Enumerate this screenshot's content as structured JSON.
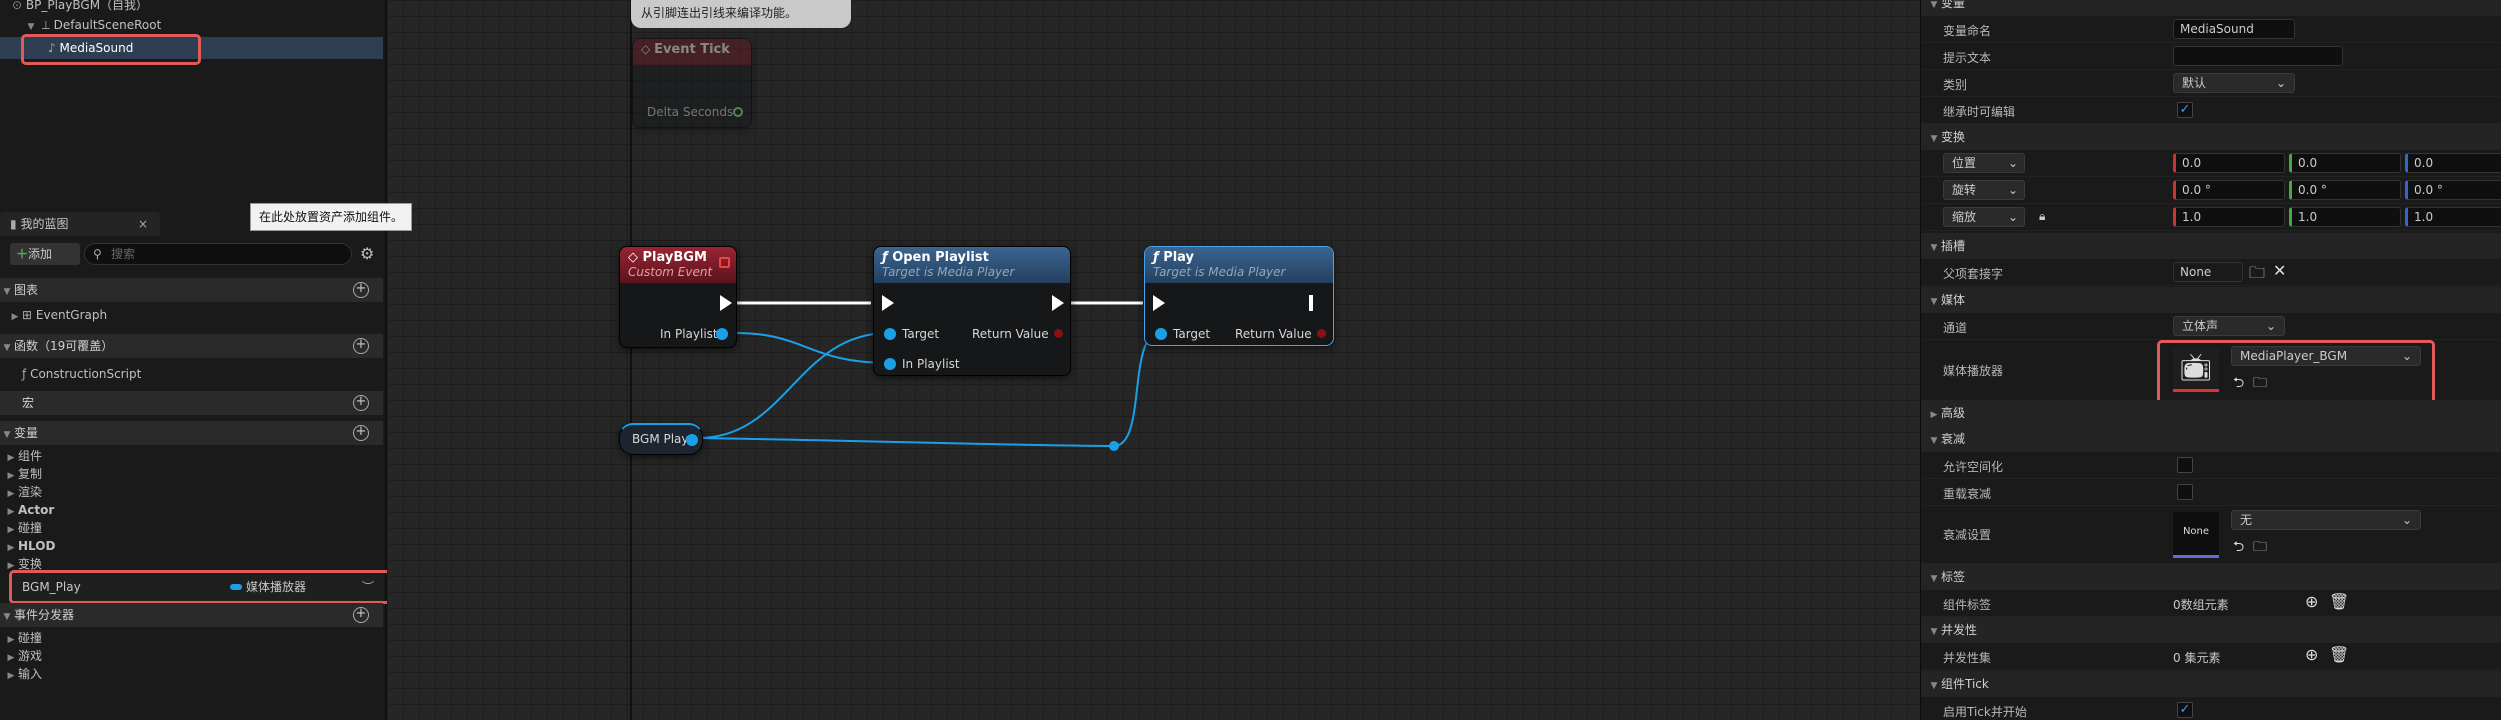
{
  "components": {
    "root_blueprint": "BP_PlayBGM（自我）",
    "scene_root": "DefaultSceneRoot",
    "media_sound": "MediaSound",
    "tooltip": "在此处放置资产添加组件。"
  },
  "my_blueprint": {
    "tab_title": "我的蓝图",
    "add_label": "添加",
    "search_placeholder": "搜索",
    "sections": {
      "graphs": "图表",
      "event_graph": "EventGraph",
      "functions": "函数（19可覆盖）",
      "construction_script": "ConstructionScript",
      "macros": "宏",
      "variables": "变量",
      "event_dispatchers": "事件分发器"
    },
    "variable_categories": [
      "组件",
      "复制",
      "渲染",
      "Actor",
      "碰撞",
      "HLOD",
      "变换"
    ],
    "variable": {
      "name": "BGM_Play",
      "type": "媒体播放器"
    },
    "dispatcher_categories": [
      "碰撞",
      "游戏",
      "输入"
    ]
  },
  "graph": {
    "comment": "从引脚连出引线来编译功能。",
    "event_tick": {
      "title": "Event Tick",
      "pin": "Delta Seconds"
    },
    "custom_event": {
      "title": "PlayBGM",
      "subtitle": "Custom Event",
      "pin": "In Playlist"
    },
    "open_playlist": {
      "title": "Open Playlist",
      "subtitle": "Target is Media Player",
      "pin_target": "Target",
      "pin_playlist": "In Playlist",
      "pin_return": "Return Value"
    },
    "play": {
      "title": "Play",
      "subtitle": "Target is Media Player",
      "pin_target": "Target",
      "pin_return": "Return Value"
    },
    "var_node": "BGM Play"
  },
  "details": {
    "var_section": "变量",
    "var_name_label": "变量命名",
    "var_name_value": "MediaSound",
    "tooltip_label": "提示文本",
    "category_label": "类别",
    "category_value": "默认",
    "editable_label": "继承时可编辑",
    "transform_section": "变换",
    "location_label": "位置",
    "rotation_label": "旋转",
    "scale_label": "缩放",
    "location": [
      "0.0",
      "0.0",
      "0.0"
    ],
    "rotation": [
      "0.0 °",
      "0.0 °",
      "0.0 °"
    ],
    "scale": [
      "1.0",
      "1.0",
      "1.0"
    ],
    "socket_section": "插槽",
    "parent_socket_label": "父项套接字",
    "parent_socket_value": "None",
    "media_section": "媒体",
    "channel_label": "通道",
    "channel_value": "立体声",
    "media_player_label": "媒体播放器",
    "media_player_value": "MediaPlayer_BGM",
    "advanced_section": "高级",
    "attenuation_section": "衰减",
    "allow_spatial_label": "允许空间化",
    "override_atten_label": "重载衰减",
    "atten_settings_label": "衰减设置",
    "atten_thumb": "None",
    "atten_value": "无",
    "tags_section": "标签",
    "component_tags_label": "组件标签",
    "component_tags_value": "0数组元素",
    "concurrency_section": "并发性",
    "concurrency_set_label": "并发性集",
    "concurrency_set_value": "0 集元素",
    "tick_section": "组件Tick",
    "tick_start_label": "启用Tick并开始"
  },
  "colors": {
    "accent_red": "#e05a5a",
    "pin_blue": "#1ba0e8",
    "event_red": "#8a1f2b",
    "func_blue": "#2a4a6a"
  }
}
